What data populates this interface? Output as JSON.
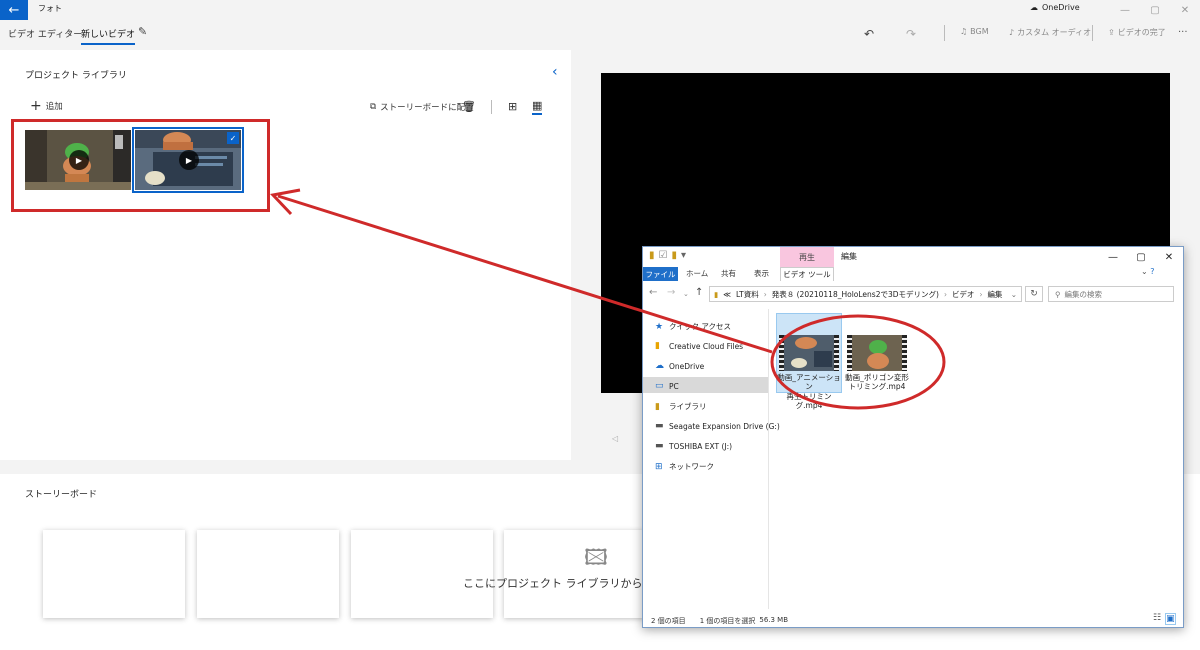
{
  "window": {
    "app_title": "フォト",
    "onedrive": "OneDrive"
  },
  "header": {
    "breadcrumb": [
      "ビデオ エディター",
      "新しいビデオ"
    ],
    "toolbar": {
      "bgm": "BGM",
      "custom_audio": "カスタム オーディオ",
      "finish_video": "ビデオの完了"
    }
  },
  "library": {
    "title": "プロジェクト ライブラリ",
    "add": "追加",
    "place_in_storyboard": "ストーリーボードに配置"
  },
  "storyboard": {
    "title": "ストーリーボード",
    "drop_hint": "ここにプロジェクト ライブラリから項目を"
  },
  "explorer": {
    "context_tab_group": "再生",
    "title": "編集",
    "ribbon_tabs": [
      "ファイル",
      "ホーム",
      "共有",
      "表示",
      "ビデオ ツール"
    ],
    "path": [
      "≪",
      "LT資料",
      "発表８ (20210118_HoloLens2で3Dモデリング)",
      "ビデオ",
      "編集"
    ],
    "search_placeholder": "編集の検索",
    "nav_items": [
      {
        "icon": "star-icon",
        "label": "クイック アクセス"
      },
      {
        "icon": "creative-cloud-icon",
        "label": "Creative Cloud Files"
      },
      {
        "icon": "cloud-icon",
        "label": "OneDrive"
      },
      {
        "icon": "monitor-icon",
        "label": "PC"
      },
      {
        "icon": "library-icon",
        "label": "ライブラリ"
      },
      {
        "icon": "drive-icon",
        "label": "Seagate Expansion Drive (G:)"
      },
      {
        "icon": "drive-icon",
        "label": "TOSHIBA EXT (J:)"
      },
      {
        "icon": "network-icon",
        "label": "ネットワーク"
      }
    ],
    "files": [
      {
        "name_line1": "動画_アニメーション",
        "name_line2": "再生トリミング.mp4",
        "selected": true
      },
      {
        "name_line1": "動画_ポリゴン変形",
        "name_line2": "トリミング.mp4",
        "selected": false
      }
    ],
    "status": {
      "items_count": "2 個の項目",
      "selection": "1 個の項目を選択",
      "size": "56.3 MB"
    }
  },
  "colors": {
    "accent": "#0a63c9",
    "annotation_red": "#cf2a2a",
    "context_tab_pink": "#f9c6df"
  }
}
